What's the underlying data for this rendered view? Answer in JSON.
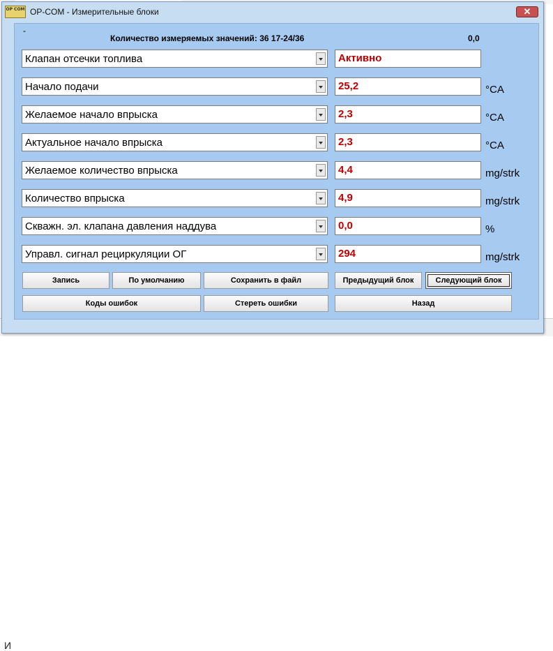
{
  "window": {
    "icon_text": "OP COM",
    "title": "OP-COM - Измерительные блоки",
    "close_symbol": "✕"
  },
  "header": {
    "dash": "-",
    "count_label": "Количество измеряемых значений: 36  17-24/36",
    "right_value": "0,0"
  },
  "rows": [
    {
      "label": "Клапан отсечки топлива",
      "value": "Активно",
      "unit": ""
    },
    {
      "label": "Начало подачи",
      "value": "25,2",
      "unit": "°CA"
    },
    {
      "label": "Желаемое начало впрыска",
      "value": "2,3",
      "unit": "°CA"
    },
    {
      "label": "Актуальное начало впрыска",
      "value": "2,3",
      "unit": "°CA"
    },
    {
      "label": "Желаемое количество впрыска",
      "value": "4,4",
      "unit": "mg/strk"
    },
    {
      "label": "Количество впрыска",
      "value": "4,9",
      "unit": "mg/strk"
    },
    {
      "label": "Скважн. эл. клапана давления наддува",
      "value": "0,0",
      "unit": "%"
    },
    {
      "label": "Управл. сигнал рециркуляции ОГ",
      "value": "294",
      "unit": "mg/strk"
    }
  ],
  "buttons": {
    "record": "Запись",
    "default": "По умолчанию",
    "save_file": "Сохранить в файл",
    "prev_block": "Предыдущий блок",
    "next_block": "Следующий блок",
    "error_codes": "Коды ошибок",
    "clear_errors": "Стереть ошибки",
    "back": "Назад"
  },
  "background": {
    "status_letter": "И"
  },
  "colors": {
    "client_bg": "#a6caf0",
    "value_text": "#c00000"
  }
}
